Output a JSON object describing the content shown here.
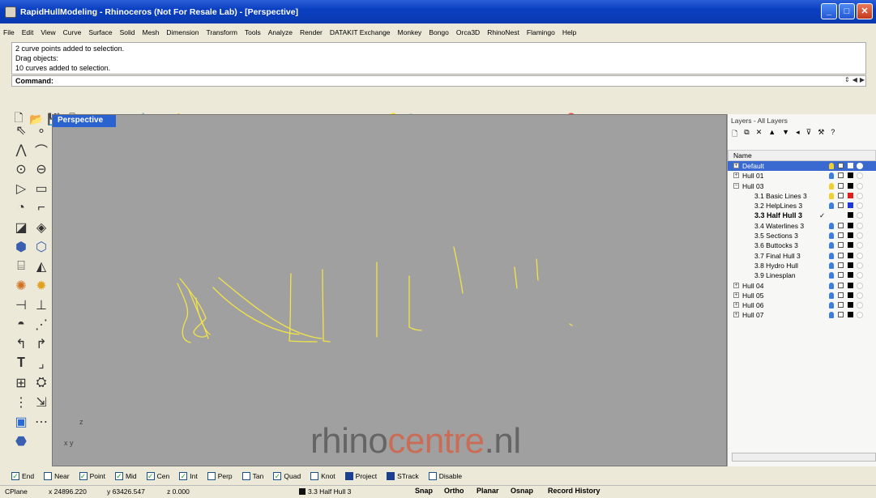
{
  "window": {
    "title": "RapidHullModeling - Rhinoceros (Not For Resale Lab) - [Perspective]"
  },
  "menu": [
    "File",
    "Edit",
    "View",
    "Curve",
    "Surface",
    "Solid",
    "Mesh",
    "Dimension",
    "Transform",
    "Tools",
    "Analyze",
    "Render",
    "DATAKIT Exchange",
    "Monkey",
    "Bongo",
    "Orca3D",
    "RhinoNest",
    "Flamingo",
    "Help"
  ],
  "command": {
    "history": [
      "2 curve points added to selection.",
      "Drag objects:",
      "10 curves added to selection."
    ],
    "prompt": "Command:"
  },
  "viewport": {
    "label": "Perspective",
    "axis_z": "z",
    "axis_xy": "x y",
    "background": "#a0a0a0",
    "curve_color": "#f2e34a"
  },
  "watermark": {
    "part1": "rhino",
    "part2": "centre",
    "part3": ".nl"
  },
  "layers": {
    "panel_title": "Layers - All Layers",
    "column_name": "Name",
    "rows": [
      {
        "name": "Default",
        "expander": "+",
        "selected": true
      },
      {
        "name": "Hull 01",
        "expander": "+"
      },
      {
        "name": "Hull 03",
        "expander": "-"
      },
      {
        "name": "3.1 Basic Lines 3",
        "indent": true,
        "color": "#e02020"
      },
      {
        "name": "3.2 HelpLines 3",
        "indent": true,
        "color": "#1c38d8"
      },
      {
        "name": "3.3 Half Hull 3",
        "indent": true,
        "current": true,
        "check": "✓"
      },
      {
        "name": "3.4 Waterlines 3",
        "indent": true
      },
      {
        "name": "3.5 Sections 3",
        "indent": true
      },
      {
        "name": "3.6 Buttocks 3",
        "indent": true
      },
      {
        "name": "3.7 Final Hull 3",
        "indent": true
      },
      {
        "name": "3.8 Hydro Hull",
        "indent": true
      },
      {
        "name": "3.9 Linesplan",
        "indent": true
      },
      {
        "name": "Hull 04",
        "expander": "+"
      },
      {
        "name": "Hull 05",
        "expander": "+"
      },
      {
        "name": "Hull 06",
        "expander": "+"
      },
      {
        "name": "Hull 07",
        "expander": "+"
      }
    ]
  },
  "osnap": [
    {
      "label": "End",
      "checked": true
    },
    {
      "label": "Near",
      "checked": false
    },
    {
      "label": "Point",
      "checked": true
    },
    {
      "label": "Mid",
      "checked": true
    },
    {
      "label": "Cen",
      "checked": true
    },
    {
      "label": "Int",
      "checked": true
    },
    {
      "label": "Perp",
      "checked": false
    },
    {
      "label": "Tan",
      "checked": false
    },
    {
      "label": "Quad",
      "checked": true
    },
    {
      "label": "Knot",
      "checked": false
    },
    {
      "label": "Project",
      "filled": true
    },
    {
      "label": "STrack",
      "filled": true
    },
    {
      "label": "Disable",
      "checked": false
    }
  ],
  "status": {
    "cplane": "CPlane",
    "x": "x 24896.220",
    "y": "y 63426.547",
    "z": "z 0.000",
    "layer": "3.3 Half Hull 3",
    "buttons": [
      "Snap",
      "Ortho",
      "Planar",
      "Osnap",
      "Record History"
    ]
  }
}
